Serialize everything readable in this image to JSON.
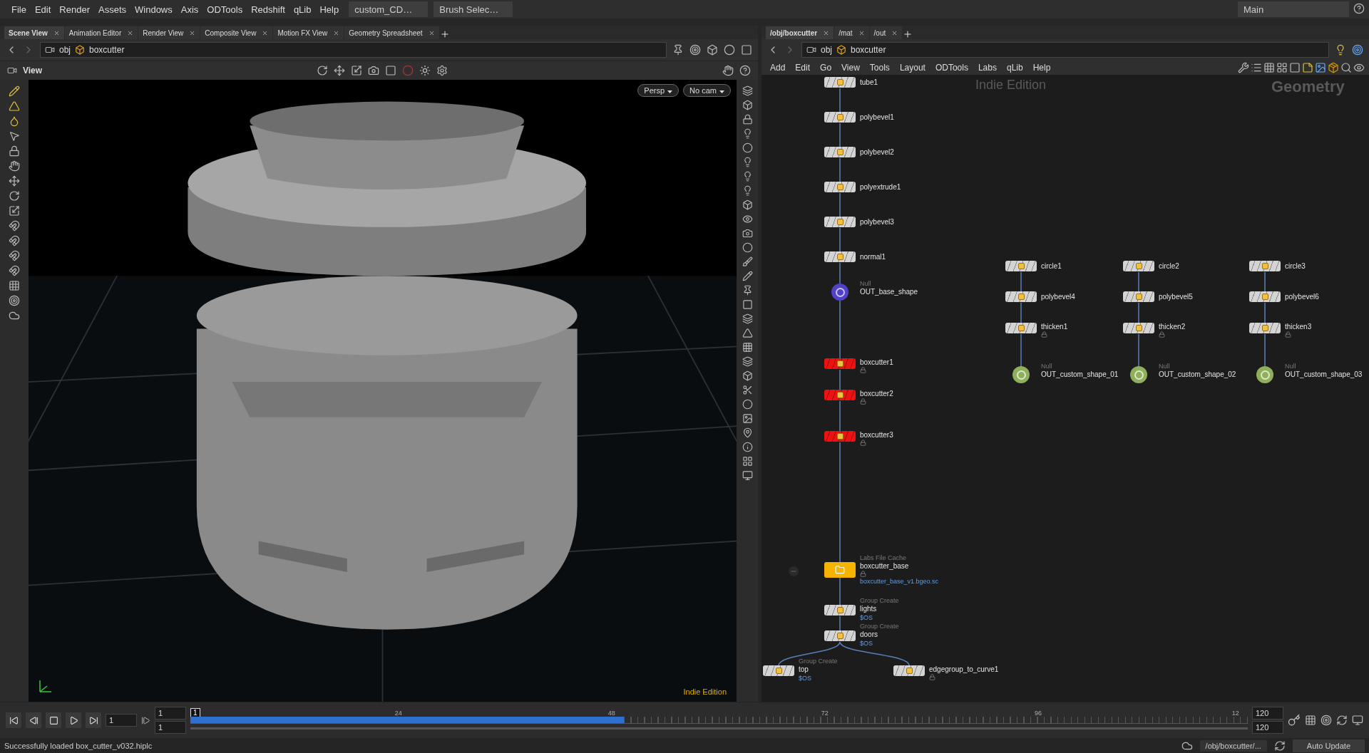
{
  "menubar": {
    "items": [
      "File",
      "Edit",
      "Render",
      "Assets",
      "Windows",
      "Axis",
      "ODTools",
      "Redshift",
      "qLib",
      "Help"
    ],
    "selectors": [
      "custom_CD…",
      "Brush Selec…"
    ],
    "desktop": "Main"
  },
  "scene_pane": {
    "tabs": [
      {
        "label": "Scene View",
        "selected": true
      },
      {
        "label": "Animation Editor",
        "selected": false
      },
      {
        "label": "Render View",
        "selected": false
      },
      {
        "label": "Composite View",
        "selected": false
      },
      {
        "label": "Motion FX View",
        "selected": false
      },
      {
        "label": "Geometry Spreadsheet",
        "selected": false
      }
    ],
    "path": [
      "obj",
      "boxcutter"
    ],
    "viewer": {
      "title": "View",
      "camera_buttons": [
        "Persp",
        "No cam"
      ],
      "watermark": "Indie Edition"
    }
  },
  "network_pane": {
    "tabs": [
      {
        "label": "/obj/boxcutter",
        "selected": true
      },
      {
        "label": "/mat",
        "selected": false
      },
      {
        "label": "/out",
        "selected": false
      }
    ],
    "path": [
      "obj",
      "boxcutter"
    ],
    "menu": [
      "Add",
      "Edit",
      "Go",
      "View",
      "Tools",
      "Layout",
      "ODTools",
      "Labs",
      "qLib",
      "Help"
    ],
    "watermark": "Indie Edition",
    "context": "Geometry",
    "nodes": [
      {
        "label": "tube1",
        "kind": "sop",
        "color": "#d4d4d4",
        "locked": false
      },
      {
        "label": "polybevel1",
        "kind": "sop",
        "color": "#d4d4d4",
        "locked": false
      },
      {
        "label": "polybevel2",
        "kind": "sop",
        "color": "#d4d4d4",
        "locked": false
      },
      {
        "label": "polyextrude1",
        "kind": "sop",
        "color": "#d4d4d4",
        "locked": false
      },
      {
        "label": "polybevel3",
        "kind": "sop",
        "color": "#d4d4d4",
        "locked": false
      },
      {
        "label": "normal1",
        "kind": "sop",
        "color": "#d4d4d4",
        "locked": false
      },
      {
        "label": "OUT_base_shape",
        "type_label": "Null",
        "kind": "null",
        "color": "#5041c8",
        "locked": false
      },
      {
        "label": "boxcutter1",
        "kind": "sop",
        "color": "#ee1111",
        "locked": true
      },
      {
        "label": "boxcutter2",
        "kind": "sop",
        "color": "#ee1111",
        "locked": true
      },
      {
        "label": "boxcutter3",
        "kind": "sop",
        "color": "#ee1111",
        "locked": true
      },
      {
        "label": "boxcutter_base",
        "type_label": "Labs File Cache",
        "subtext": "boxcutter_base_v1.bgeo.sc",
        "kind": "cache",
        "color": "#f5b400",
        "locked": true
      },
      {
        "label": "lights",
        "type_label": "Group Create",
        "subtext": "$OS",
        "kind": "sop",
        "color": "#d4d4d4",
        "locked": false
      },
      {
        "label": "doors",
        "type_label": "Group Create",
        "subtext": "$OS",
        "kind": "sop",
        "color": "#d4d4d4",
        "locked": false
      },
      {
        "label": "top",
        "type_label": "Group Create",
        "subtext": "$OS",
        "kind": "sop",
        "color": "#d4d4d4",
        "locked": false
      },
      {
        "label": "edgegroup_to_curve1",
        "kind": "sop",
        "color": "#d4d4d4",
        "locked": true
      },
      {
        "label": "circle1",
        "kind": "sop",
        "color": "#d4d4d4",
        "locked": false
      },
      {
        "label": "polybevel4",
        "kind": "sop",
        "color": "#d4d4d4",
        "locked": false
      },
      {
        "label": "thicken1",
        "kind": "sop",
        "color": "#d4d4d4",
        "locked": true
      },
      {
        "label": "OUT_custom_shape_01",
        "type_label": "Null",
        "kind": "null",
        "color": "#8fb05a",
        "locked": false
      },
      {
        "label": "circle2",
        "kind": "sop",
        "color": "#d4d4d4",
        "locked": false
      },
      {
        "label": "polybevel5",
        "kind": "sop",
        "color": "#d4d4d4",
        "locked": false
      },
      {
        "label": "thicken2",
        "kind": "sop",
        "color": "#d4d4d4",
        "locked": true
      },
      {
        "label": "OUT_custom_shape_02",
        "type_label": "Null",
        "kind": "null",
        "color": "#8fb05a",
        "locked": false
      },
      {
        "label": "circle3",
        "kind": "sop",
        "color": "#d4d4d4",
        "locked": false
      },
      {
        "label": "polybevel6",
        "kind": "sop",
        "color": "#d4d4d4",
        "locked": false
      },
      {
        "label": "thicken3",
        "kind": "sop",
        "color": "#d4d4d4",
        "locked": true
      },
      {
        "label": "OUT_custom_shape_03",
        "type_label": "Null",
        "kind": "null",
        "color": "#8fb05a",
        "locked": false
      }
    ]
  },
  "timeline": {
    "frame": "1",
    "start": [
      "1",
      "1"
    ],
    "end": [
      "120",
      "120"
    ],
    "current_marker": "1",
    "ticks": [
      "24",
      "48",
      "72",
      "96",
      "12"
    ],
    "level": 0.41
  },
  "status_bar": {
    "message": "Successfully loaded box_cutter_v032.hiplc",
    "path": "/obj/boxcutter/...",
    "update_mode": "Auto Update"
  }
}
